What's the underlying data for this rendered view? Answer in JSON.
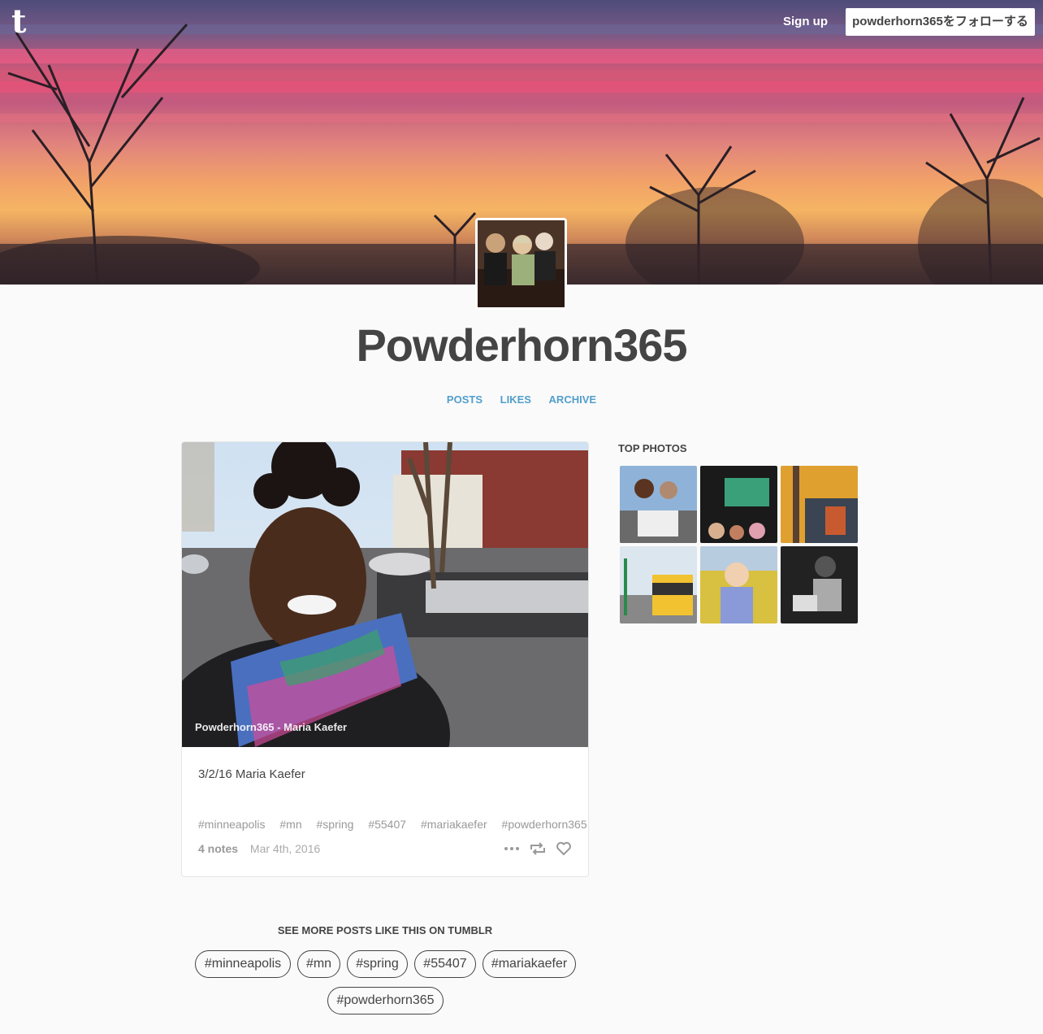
{
  "header": {
    "logo_glyph": "t",
    "signup_label": "Sign up",
    "follow_label": "powderhorn365をフォローする"
  },
  "blog": {
    "title": "Powderhorn365",
    "nav": [
      "POSTS",
      "LIKES",
      "ARCHIVE"
    ]
  },
  "post": {
    "photo_watermark": "Powderhorn365 - Maria Kaefer",
    "caption": "3/2/16 Maria Kaefer",
    "tags": [
      "#minneapolis",
      "#mn",
      "#spring",
      "#55407",
      "#mariakaefer",
      "#powderhorn365"
    ],
    "notes": "4 notes",
    "date": "Mar 4th, 2016",
    "actions": [
      "more-icon",
      "reblog-icon",
      "like-icon"
    ]
  },
  "sidebar": {
    "title": "TOP PHOTOS"
  },
  "see_more": {
    "title": "SEE MORE POSTS LIKE THIS ON TUMBLR",
    "tags": [
      "#minneapolis",
      "#mn",
      "#spring",
      "#55407",
      "#mariakaefer",
      "#powderhorn365"
    ]
  },
  "colors": {
    "accent": "#529ecc",
    "text": "#444444",
    "background": "#fafafa"
  }
}
